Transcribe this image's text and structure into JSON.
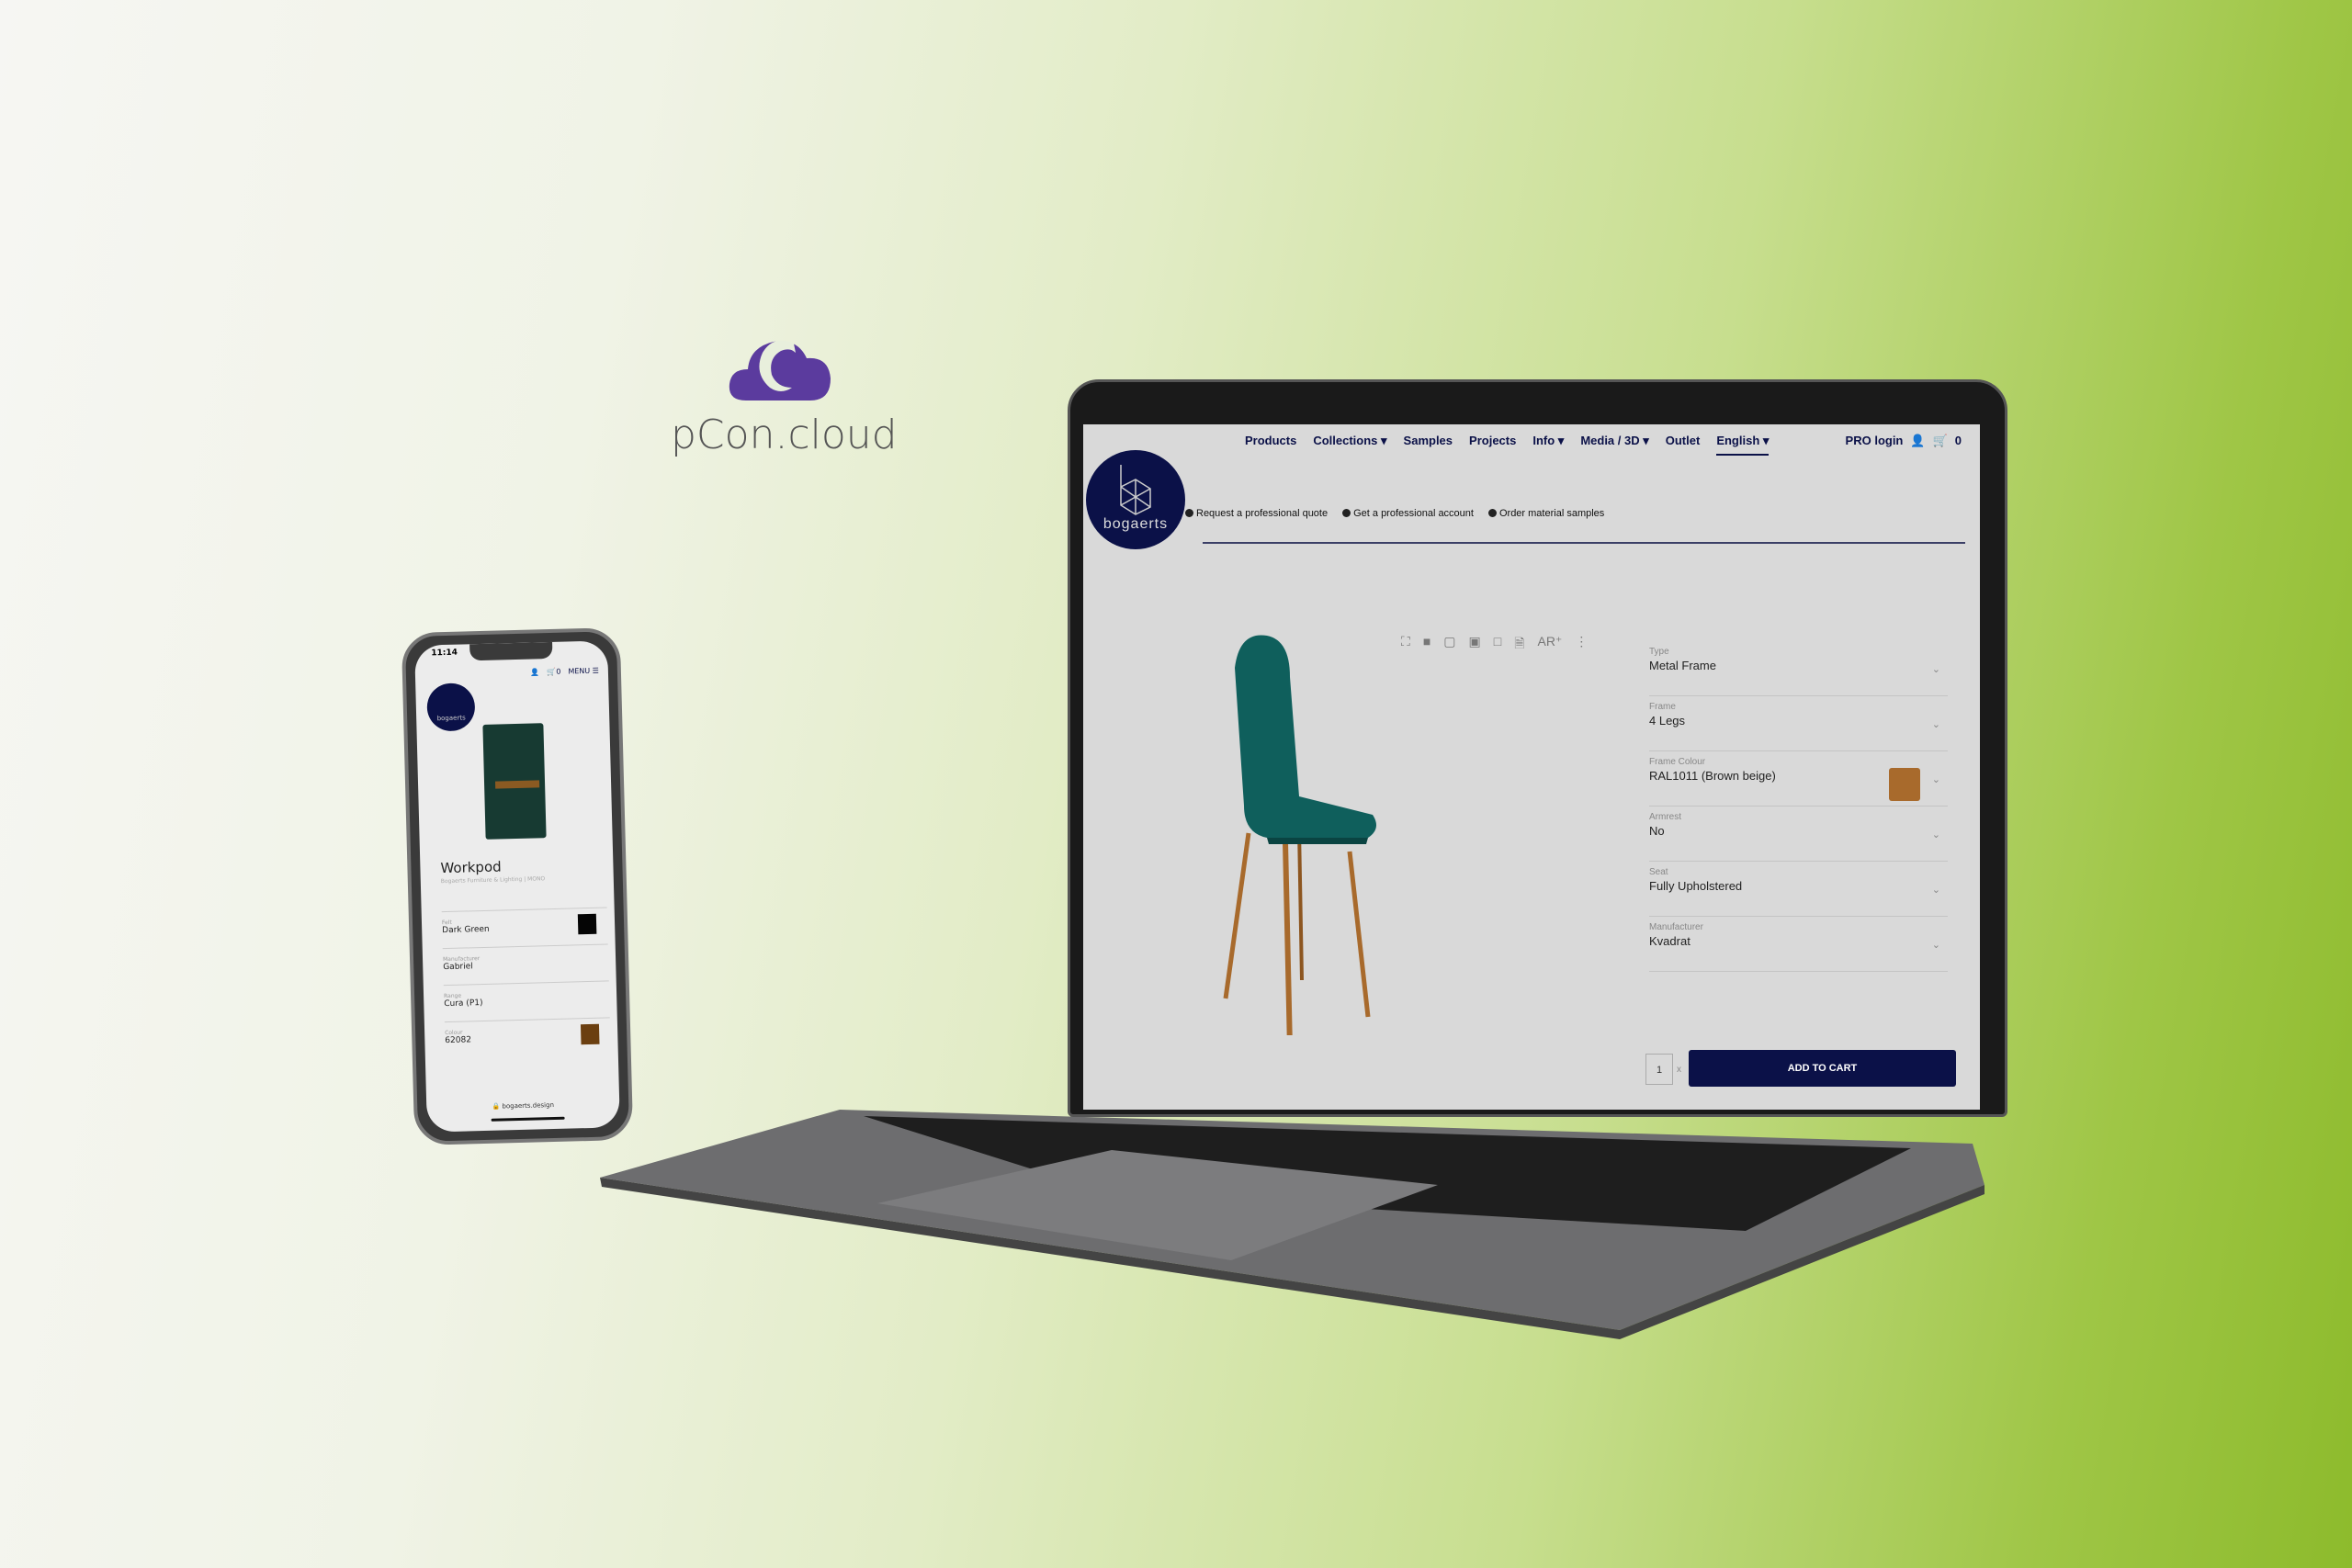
{
  "brand": {
    "name": "pCon.cloud",
    "color": "#5b3b9e"
  },
  "laptop": {
    "nav": {
      "items": [
        "Products",
        "Collections ▾",
        "Samples",
        "Projects",
        "Info ▾",
        "Media / 3D ▾",
        "Outlet",
        "English ▾"
      ],
      "active": "English ▾",
      "pro_login": "PRO login",
      "cart_count": "0"
    },
    "logo_text": "bogaerts",
    "info_links": [
      "Request a professional quote",
      "Get a professional account",
      "Order material samples"
    ],
    "toolbar": [
      "fullscreen-icon",
      "cube-solid-icon",
      "cube-wire-icon",
      "cube-shaded-icon",
      "cube-outline-icon",
      "document-icon",
      "AR",
      "more-icon"
    ],
    "toolbar_ar": "AR⁺",
    "toolbar_more": "⋮",
    "options": [
      {
        "label": "Type",
        "value": "Metal Frame"
      },
      {
        "label": "Frame",
        "value": "4 Legs"
      },
      {
        "label": "Frame Colour",
        "value": "RAL1011 (Brown beige)",
        "swatch": "#a86a2c"
      },
      {
        "label": "Armrest",
        "value": "No"
      },
      {
        "label": "Seat",
        "value": "Fully Upholstered"
      },
      {
        "label": "Manufacturer",
        "value": "Kvadrat"
      }
    ],
    "quantity": "1",
    "qty_x": "x",
    "add_to_cart": "ADD TO CART",
    "accent": "#0b1148"
  },
  "phone": {
    "time": "11:14",
    "cart_count": "0",
    "menu": "MENU ☰",
    "logo_text": "bogaerts",
    "product_title": "Workpod",
    "product_subtitle": "Bogaerts Furniture & Lighting | MONO",
    "options": [
      {
        "label": "Felt",
        "value": "Dark Green",
        "swatch": "#050505"
      },
      {
        "label": "Manufacturer",
        "value": "Gabriel"
      },
      {
        "label": "Range",
        "value": "Cura (P1)"
      },
      {
        "label": "Colour",
        "value": "62082",
        "swatch": "#6b3f10"
      }
    ],
    "url": "🔒 bogaerts.design"
  }
}
